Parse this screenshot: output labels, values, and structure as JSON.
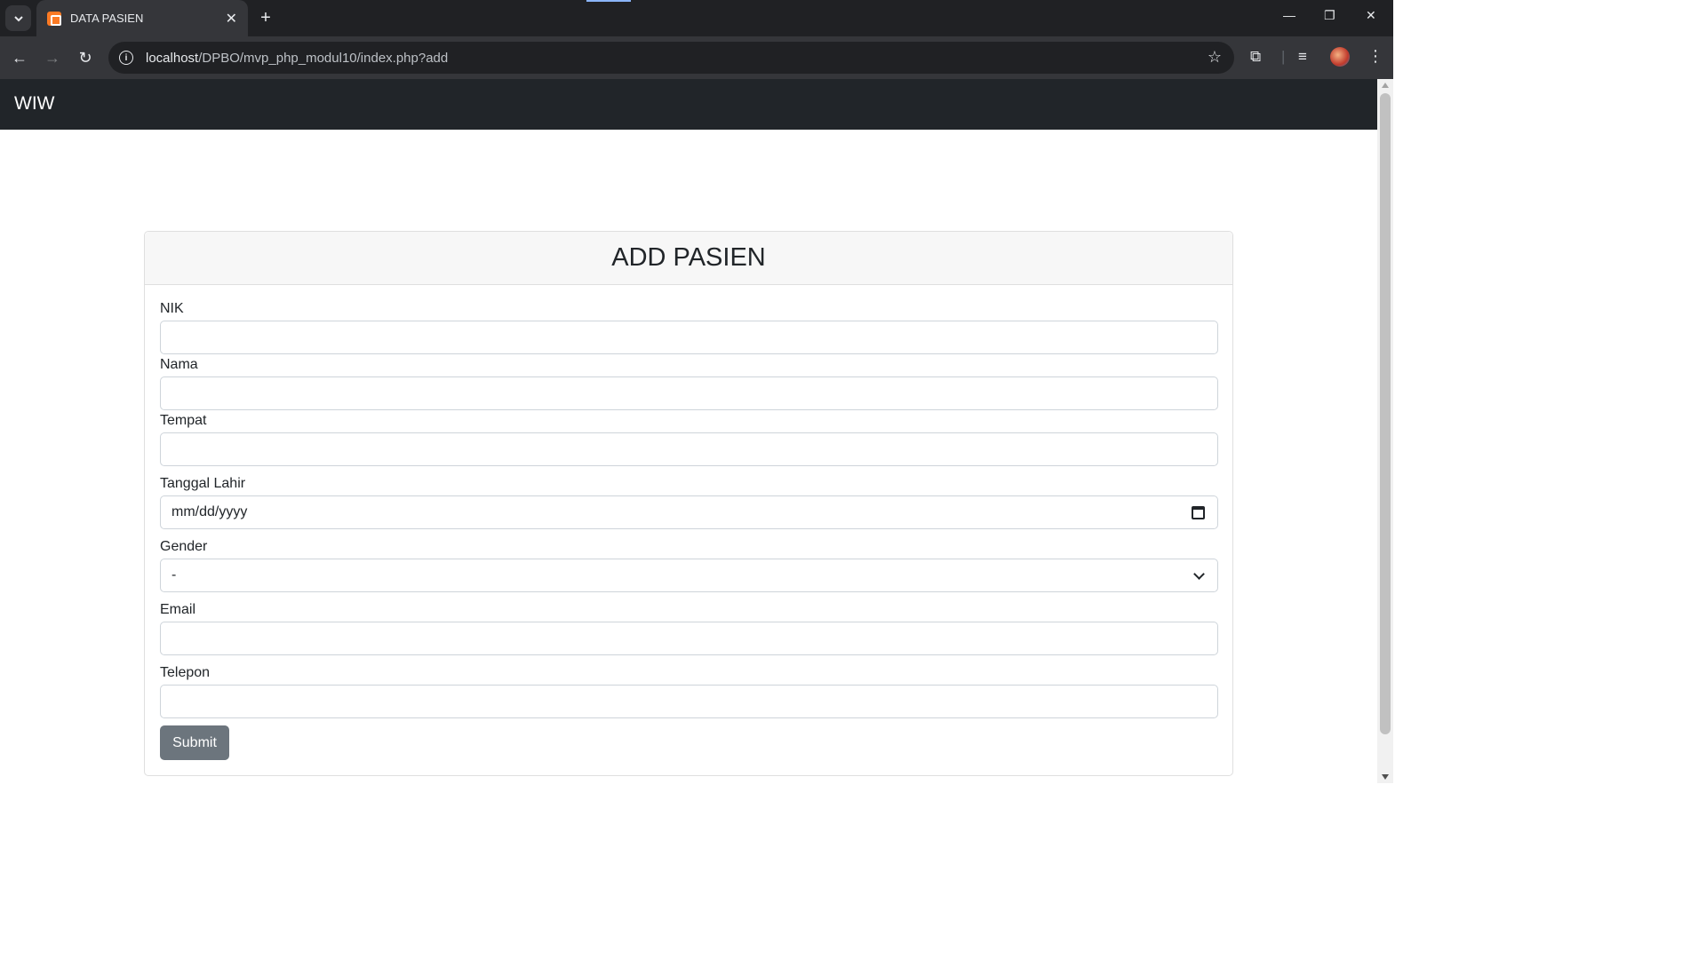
{
  "browser": {
    "tab_title": "DATA PASIEN",
    "url_host": "localhost",
    "url_path": "/DPBO/mvp_php_modul10/index.php?add"
  },
  "navbar": {
    "brand": "WIW"
  },
  "form": {
    "title": "ADD PASIEN",
    "fields": [
      {
        "label": "NIK",
        "value": ""
      },
      {
        "label": "Nama",
        "value": ""
      },
      {
        "label": "Tempat",
        "value": ""
      },
      {
        "label": "Tanggal Lahir",
        "value": "mm/dd/yyyy"
      },
      {
        "label": "Gender",
        "value": "-"
      },
      {
        "label": "Email",
        "value": ""
      },
      {
        "label": "Telepon",
        "value": ""
      }
    ],
    "submit_label": "Submit"
  },
  "colors": {
    "navbar_bg": "#212529",
    "button_bg": "#6c757d",
    "favicon": "#fb7a24"
  }
}
